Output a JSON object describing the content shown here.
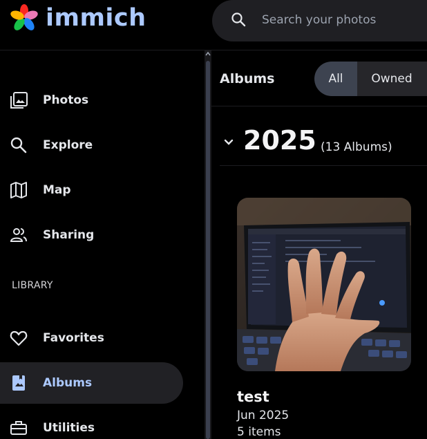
{
  "app": {
    "name": "immich"
  },
  "search": {
    "placeholder": "Search your photos",
    "value": ""
  },
  "sidebar": {
    "items": [
      {
        "label": "Photos",
        "icon": "photos-icon"
      },
      {
        "label": "Explore",
        "icon": "explore-icon"
      },
      {
        "label": "Map",
        "icon": "map-icon"
      },
      {
        "label": "Sharing",
        "icon": "sharing-icon"
      }
    ],
    "library_label": "LIBRARY",
    "library_items": [
      {
        "label": "Favorites",
        "icon": "heart-icon"
      },
      {
        "label": "Albums",
        "icon": "albums-icon",
        "active": true
      },
      {
        "label": "Utilities",
        "icon": "toolbox-icon"
      }
    ]
  },
  "main": {
    "title": "Albums",
    "filters": [
      {
        "label": "All",
        "selected": true
      },
      {
        "label": "Owned",
        "selected": false
      }
    ],
    "group": {
      "year": "2025",
      "count": "(13 Albums)"
    },
    "albums": [
      {
        "name": "test",
        "date": "Jun 2025",
        "items": "5 items"
      }
    ]
  },
  "colors": {
    "accent": "#acc9ff",
    "background": "#000000",
    "active_bg": "#212125"
  }
}
